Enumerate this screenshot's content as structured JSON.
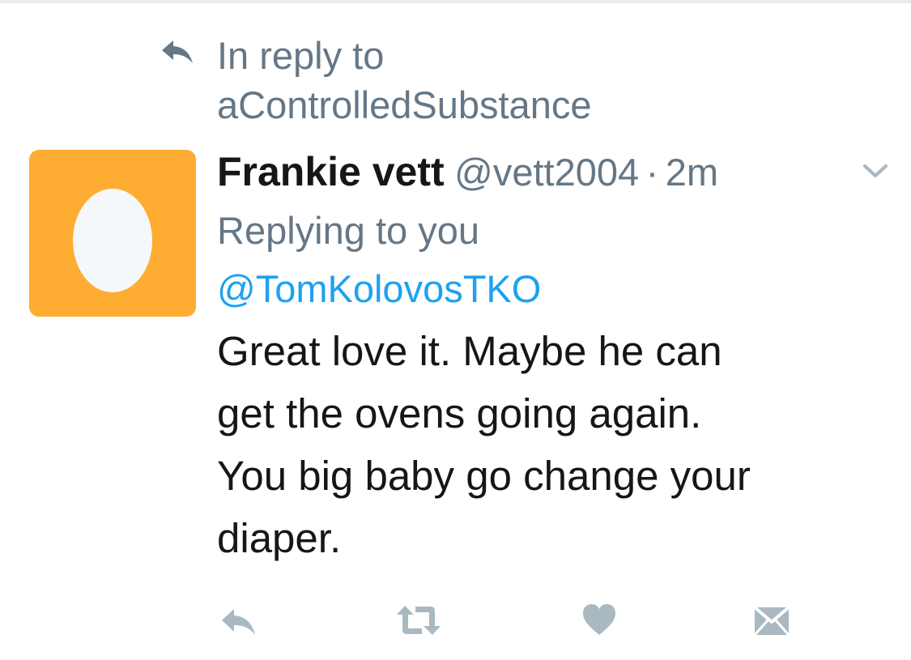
{
  "reply_context": {
    "icon": "reply-arrow-icon",
    "line1": "In reply to",
    "line2": "aControlledSubstance"
  },
  "tweet": {
    "avatar_icon": "egg-avatar-icon",
    "avatar_bg": "#ffac33",
    "display_name": "Frankie vett",
    "handle": "@vett2004",
    "separator": "·",
    "time": "2m",
    "replying_to_label": "Replying to you",
    "mention": "@TomKolovosTKO",
    "body_lines": [
      "Great love it. Maybe he can",
      "get the ovens going again.",
      "You big baby go change your",
      "diaper."
    ]
  },
  "actions": [
    {
      "name": "reply",
      "icon": "reply-icon"
    },
    {
      "name": "retweet",
      "icon": "retweet-icon"
    },
    {
      "name": "like",
      "icon": "heart-icon"
    },
    {
      "name": "direct-message",
      "icon": "envelope-icon"
    }
  ],
  "colors": {
    "text_primary": "#14171a",
    "text_secondary": "#657786",
    "link": "#1da1f2",
    "icon_gray": "#aab8c2"
  }
}
